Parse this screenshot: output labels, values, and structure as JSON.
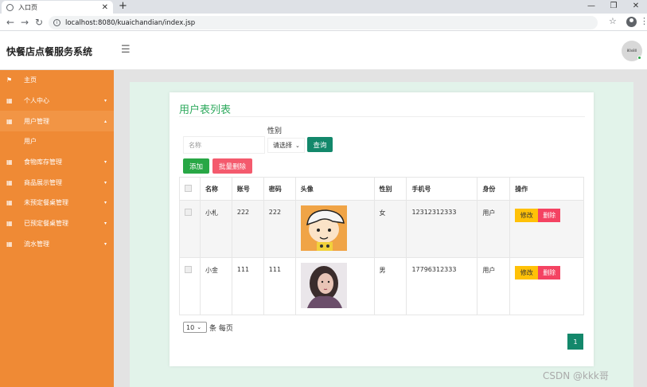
{
  "browser": {
    "tab_title": "入口页",
    "url": "localhost:8080/kuaichandian/index.jsp"
  },
  "header": {
    "app_title": "快餐店点餐服务系统",
    "avatar_text": "80x80"
  },
  "sidebar": {
    "items": [
      {
        "label": "主页"
      },
      {
        "label": "个人中心"
      },
      {
        "label": "用户管理"
      },
      {
        "label": "用户"
      },
      {
        "label": "食物库存管理"
      },
      {
        "label": "商品展示管理"
      },
      {
        "label": "未预定餐桌管理"
      },
      {
        "label": "已预定餐桌管理"
      },
      {
        "label": "流水管理"
      }
    ]
  },
  "main": {
    "title": "用户表列表",
    "search": {
      "name_placeholder": "名称",
      "gender_label": "性别",
      "gender_selected": "请选择",
      "query_button": "查询"
    },
    "add_button": "添加",
    "bulk_delete_button": "批量删除",
    "table": {
      "columns": [
        "名称",
        "账号",
        "密码",
        "头像",
        "性别",
        "手机号",
        "身份",
        "操作"
      ],
      "rows": [
        {
          "name": "小札",
          "account": "222",
          "password": "222",
          "gender": "女",
          "phone": "12312312333",
          "role": "用户",
          "edit": "修改",
          "delete": "删除"
        },
        {
          "name": "小金",
          "account": "111",
          "password": "111",
          "gender": "男",
          "phone": "17796312333",
          "role": "用户",
          "edit": "修改",
          "delete": "删除"
        }
      ]
    },
    "pagination": {
      "page_size": "10",
      "per_page_text": "条 每页",
      "current_page": "1"
    }
  },
  "watermark": "CSDN @kkk哥"
}
